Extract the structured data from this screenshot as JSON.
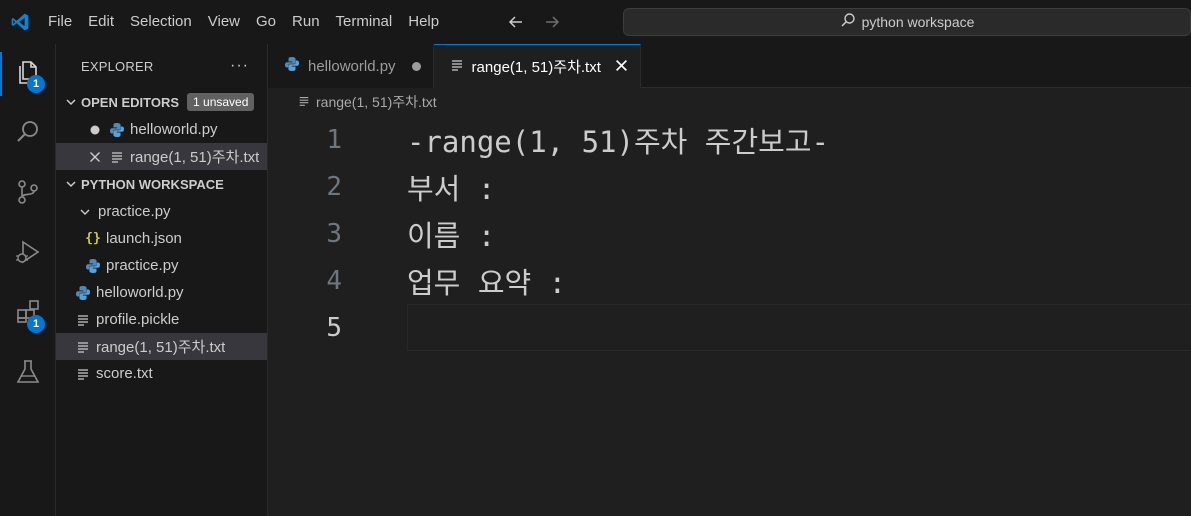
{
  "menu": [
    "File",
    "Edit",
    "Selection",
    "View",
    "Go",
    "Run",
    "Terminal",
    "Help"
  ],
  "search": {
    "text": "python workspace"
  },
  "activity": {
    "explorer_badge": "1",
    "extensions_badge": "1",
    "icons": [
      "files-icon",
      "search-icon",
      "source-control-icon",
      "run-debug-icon",
      "extensions-icon",
      "testing-icon"
    ]
  },
  "explorer": {
    "title": "EXPLORER",
    "more": "···",
    "open_editors": {
      "title": "OPEN EDITORS",
      "badge": "1 unsaved",
      "items": [
        {
          "label": "helloworld.py",
          "state": "modified"
        },
        {
          "label": "range(1, 51)주차.txt",
          "state": "close"
        }
      ]
    },
    "workspace": {
      "title": "PYTHON WORKSPACE",
      "items": [
        {
          "label": "practice.py",
          "kind": "folder"
        },
        {
          "label": "launch.json",
          "kind": "json"
        },
        {
          "label": "practice.py",
          "kind": "python"
        },
        {
          "label": "helloworld.py",
          "kind": "python"
        },
        {
          "label": "profile.pickle",
          "kind": "text"
        },
        {
          "label": "range(1, 51)주차.txt",
          "kind": "text"
        },
        {
          "label": "score.txt",
          "kind": "text"
        }
      ]
    }
  },
  "tabs": [
    {
      "label": "helloworld.py",
      "active": false
    },
    {
      "label": "range(1, 51)주차.txt",
      "active": true
    }
  ],
  "breadcrumb": "range(1, 51)주차.txt",
  "editor_lines": [
    {
      "num": "1",
      "text": "-range(1, 51)주차 주간보고-"
    },
    {
      "num": "2",
      "text": "부서 :"
    },
    {
      "num": "3",
      "text": "이름 :"
    },
    {
      "num": "4",
      "text": "업무 요약 :"
    },
    {
      "num": "5",
      "text": ""
    }
  ],
  "colors": {
    "accent": "#0078d4",
    "python_blue": "#4b8bbe",
    "python_yellow": "#ffd43b",
    "json_yellow": "#cbcb41"
  }
}
